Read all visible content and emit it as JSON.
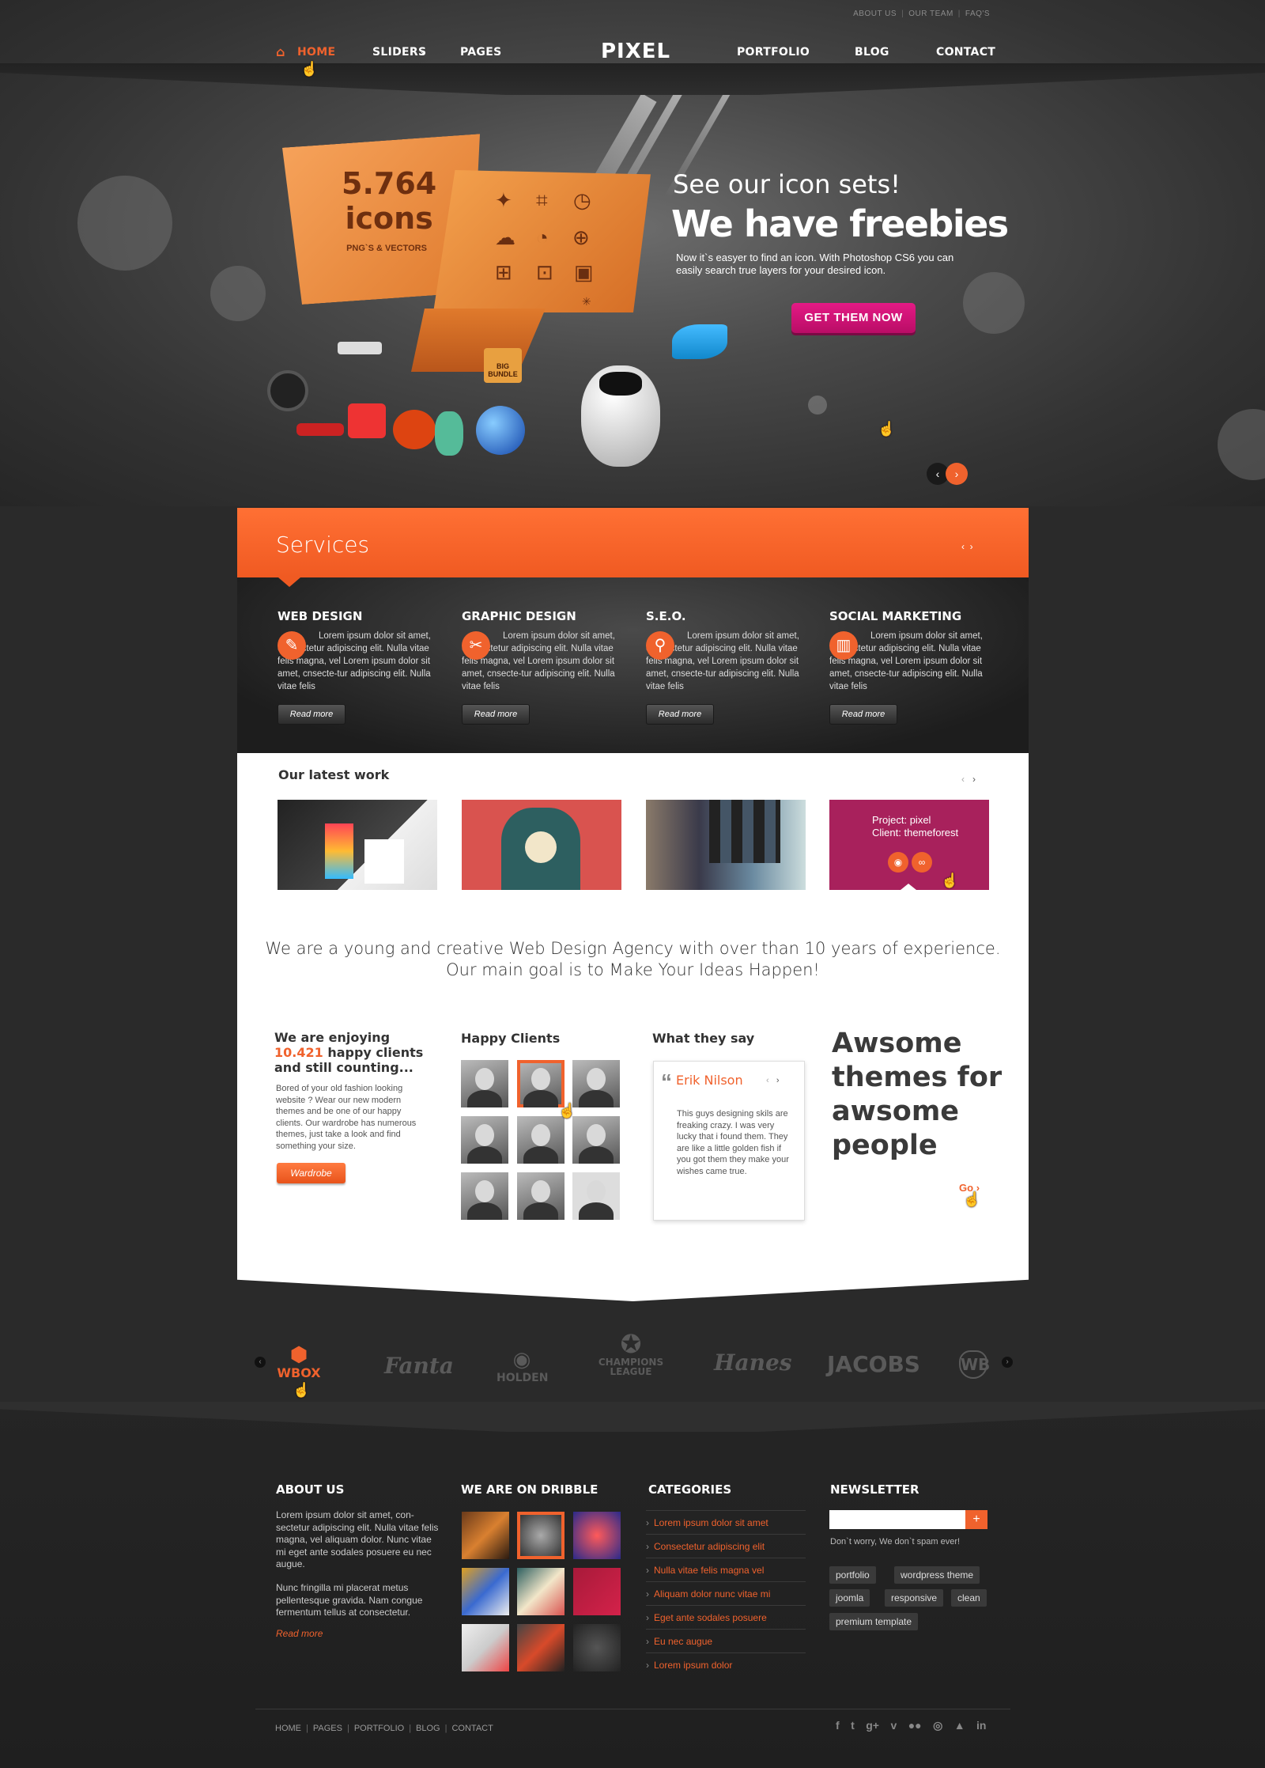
{
  "top_links": [
    "ABOUT US",
    "OUR TEAM",
    "FAQ'S"
  ],
  "nav": {
    "home": "HOME",
    "sliders": "SLIDERS",
    "pages": "PAGES",
    "logo": "PIXEL",
    "portfolio": "PORTFOLIO",
    "blog": "BLOG",
    "contact": "CONTACT"
  },
  "hero": {
    "count": "5.764",
    "count_word": "icons",
    "count_sub": "PNG`S & VECTORS",
    "small_title": "See our icon sets!",
    "big_title": "We have freebies",
    "text": "Now it`s easyer to find an icon. With Photoshop CS6 you can easily search true layers for your desired icon.",
    "button": "GET THEM NOW",
    "box_label": "BIG BUNDLE",
    "active_slide": 1,
    "slide_count": 5
  },
  "services": {
    "title": "Services",
    "items": [
      {
        "title": "WEB DESIGN",
        "icon": "brush-icon",
        "text": "Lorem ipsum dolor sit amet, consectetur adipiscing elit. Nulla vitae felis magna, vel Lorem ipsum dolor sit amet, cnsecte-tur adipiscing elit. Nulla vitae felis",
        "button": "Read more"
      },
      {
        "title": "GRAPHIC DESIGN",
        "icon": "tools-icon",
        "text": "Lorem ipsum dolor sit amet, consectetur adipiscing elit. Nulla vitae felis magna, vel Lorem ipsum dolor sit amet, cnsecte-tur adipiscing elit. Nulla vitae felis",
        "button": "Read more"
      },
      {
        "title": "S.E.O.",
        "icon": "search-icon",
        "text": "Lorem ipsum dolor sit amet, consectetur adipiscing elit. Nulla vitae felis magna, vel Lorem ipsum dolor sit amet, cnsecte-tur adipiscing elit. Nulla vitae felis",
        "button": "Read more"
      },
      {
        "title": "SOCIAL MARKETING",
        "icon": "chart-icon",
        "text": "Lorem ipsum dolor sit amet, consectetur adipiscing elit. Nulla vitae felis magna, vel Lorem ipsum dolor sit amet, cnsecte-tur adipiscing elit. Nulla vitae felis",
        "button": "Read more"
      }
    ]
  },
  "latest_work": {
    "title": "Our latest work",
    "overlay_project_label": "Project:",
    "overlay_project": "pixel",
    "overlay_client_label": "Client:",
    "overlay_client": "themeforest"
  },
  "tagline": {
    "line1": "We are a young and creative Web Design Agency with over than 10 years of experience.",
    "line2": "Our main goal is to Make Your Ideas Happen!"
  },
  "enjoy": {
    "prefix": "We are enjoying",
    "number": "10.421",
    "suffix": "happy clients and still counting...",
    "text": "Bored of your old fashion looking website ? Wear our new modern themes and be one of our happy clients. Our wardrobe has numerous themes, just take a look and find something your size.",
    "button": "Wardrobe"
  },
  "happy_clients": {
    "title": "Happy Clients",
    "selected_index": 1
  },
  "testimonial": {
    "title": "What they say",
    "name": "Erik Nilson",
    "text": "This guys designing skils are freaking crazy. I was very lucky that i found them. They are like a little golden fish if you got them they make your wishes came true."
  },
  "awesome": {
    "title": "Awsome themes for awsome people",
    "link": "Go"
  },
  "client_logos": [
    "WBOX",
    "Fanta",
    "HOLDEN",
    "CHAMPIONS LEAGUE",
    "Hanes",
    "JACOBS",
    "WB"
  ],
  "footer": {
    "about_title": "ABOUT US",
    "about_text1": "Lorem ipsum dolor sit amet, con-sectetur adipiscing elit. Nulla vitae felis magna, vel aliquam dolor. Nunc vitae mi eget ante sodales posuere eu nec augue.",
    "about_text2": "Nunc fringilla mi placerat metus pellentesque gravida. Nam congue fermentum tellus at consectetur.",
    "about_more": "Read more",
    "dribble_title": "WE ARE ON DRIBBLE",
    "categories_title": "CATEGORIES",
    "categories": [
      "Lorem ipsum dolor sit amet",
      "Consectetur adipiscing elit",
      "Nulla vitae felis magna vel",
      "Aliquam dolor nunc vitae mi",
      "Eget ante sodales posuere",
      "Eu nec augue",
      "Lorem ipsum dolor"
    ],
    "newsletter_title": "NEWSLETTER",
    "newsletter_note": "Don`t worry, We don`t spam ever!",
    "newsletter_button": "+",
    "tags": [
      "portfolio",
      "wordpress theme",
      "joomla",
      "responsive",
      "clean",
      "premium template"
    ]
  },
  "bottom_links": [
    "HOME",
    "PAGES",
    "PORTFOLIO",
    "BLOG",
    "CONTACT"
  ],
  "social": [
    "f",
    "twitter",
    "g+",
    "vimeo",
    "flickr",
    "dribbble",
    "forrst",
    "in"
  ],
  "colors": {
    "accent": "#f0622d",
    "hero_button": "#d9167a",
    "dark": "#2a2a2a"
  }
}
